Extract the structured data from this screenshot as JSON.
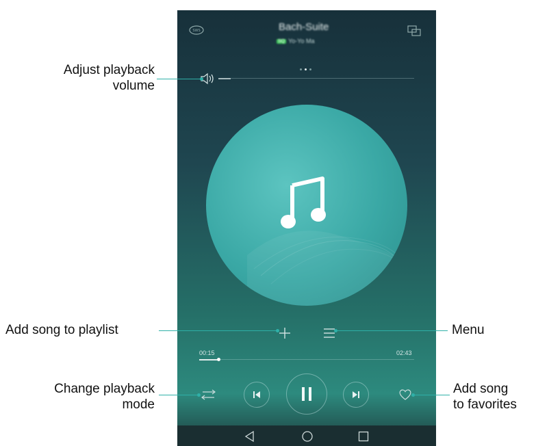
{
  "callouts": {
    "volume": "Adjust playback\nvolume",
    "playlist": "Add song to playlist",
    "mode": "Change playback\nmode",
    "menu": "Menu",
    "favorites": "Add song\nto favorites"
  },
  "player": {
    "song_title": "Bach-Suite",
    "quality_badge": "SQ",
    "artist": "Yo-Yo Ma",
    "current_time": "00:15",
    "total_time": "02:43",
    "progress": 0.09,
    "page_indicator": {
      "count": 3,
      "active": 2
    },
    "icons": [
      "equalizer-icon",
      "screen-share-icon",
      "volume-icon",
      "music-note-icon",
      "add-icon",
      "menu-icon",
      "shuffle-icon",
      "previous-icon",
      "pause-icon",
      "next-icon",
      "heart-icon",
      "back-nav-icon",
      "home-nav-icon",
      "recents-nav-icon"
    ]
  },
  "colors": {
    "accent": "#2fb0a8",
    "disc": "#3aa8a5"
  }
}
